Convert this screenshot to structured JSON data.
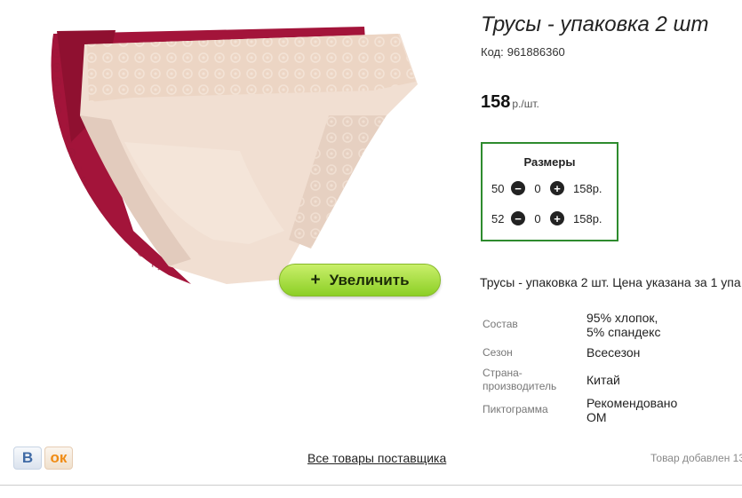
{
  "product": {
    "title": "Трусы - упаковка 2 шт",
    "code_label": "Код:",
    "code": "961886360",
    "price_value": "158",
    "price_unit": "р./шт.",
    "description": "Трусы - упаковка 2 шт. Цена указана за 1 упа"
  },
  "zoom_button": {
    "icon": "plus",
    "label": "Увеличить"
  },
  "sizes": {
    "heading": "Размеры",
    "accent_color": "#2e8b2e",
    "rows": [
      {
        "size": "50",
        "qty": "0",
        "price": "158р."
      },
      {
        "size": "52",
        "qty": "0",
        "price": "158р."
      }
    ]
  },
  "specs": [
    {
      "key": "Состав",
      "value": "95% хлопок,\n5% спандекс"
    },
    {
      "key": "Сезон",
      "value": "Всесезон"
    },
    {
      "key": "Страна-\nпроизводитель",
      "value": "Китай"
    },
    {
      "key": "Пиктограмма",
      "value": "Рекомендовано\nОМ"
    }
  ],
  "social": {
    "vk_label": "В",
    "ok_label": "ok"
  },
  "footer": {
    "all_goods_link": "Все товары поставщика",
    "added_text": "Товар добавлен 13"
  }
}
